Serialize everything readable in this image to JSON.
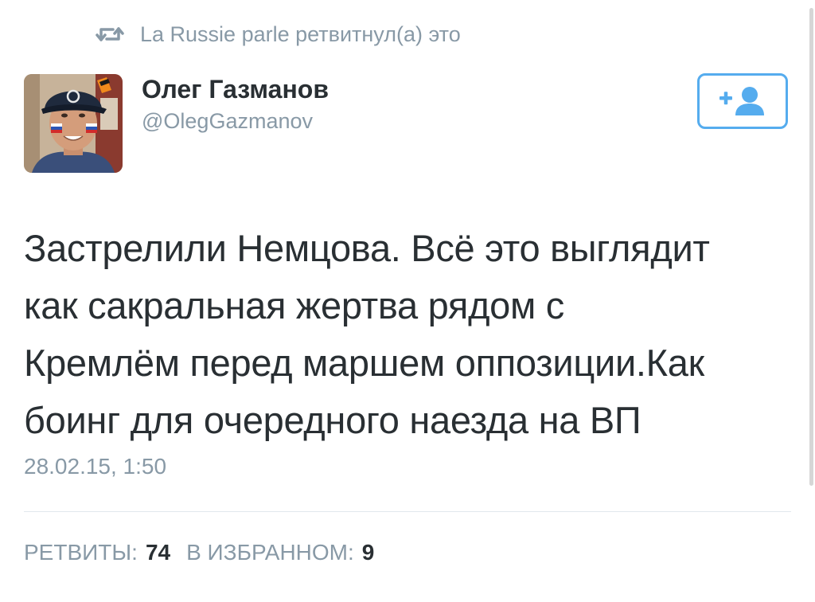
{
  "retweet_context": {
    "icon": "retweet-icon",
    "text": "La Russie parle ретвитнул(а) это"
  },
  "author": {
    "avatar": "avatar-photo",
    "display_name": "Олег Газманов",
    "username": "@OlegGazmanov"
  },
  "follow_button": {
    "icon": "follow-user-icon",
    "color": "#55acee"
  },
  "tweet": {
    "text_lines": [
      "Застрелили Немцова. Всё это выглядит",
      "как сакральная жертва рядом с",
      "Кремлём перед маршем оппозиции.Как",
      "боинг для очередного наезда на ВП"
    ],
    "timestamp": "28.02.15, 1:50"
  },
  "stats": {
    "retweets_label": "РЕТВИТЫ:",
    "retweets_count": "74",
    "favorites_label": "В ИЗБРАННОМ:",
    "favorites_count": "9"
  },
  "colors": {
    "accent": "#55acee",
    "muted_text": "#8899a6",
    "primary_text": "#292f33",
    "divider": "#e1e8ed"
  }
}
